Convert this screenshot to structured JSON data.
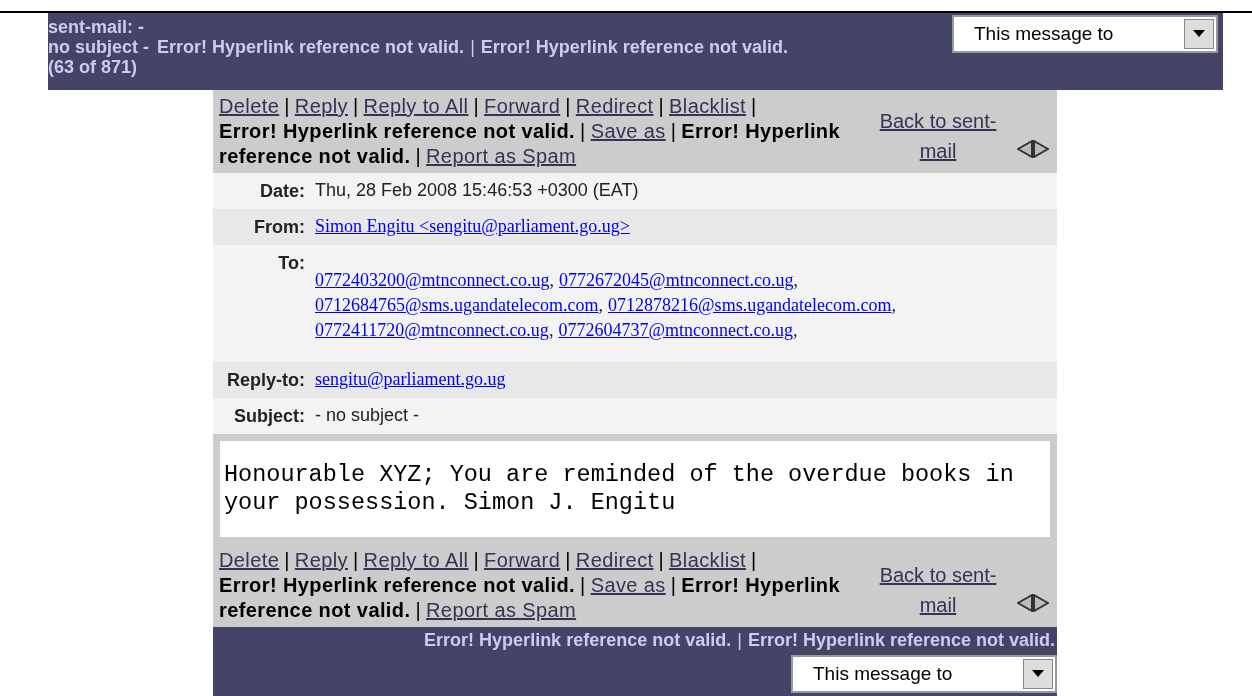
{
  "top_bar": {
    "folder": "sent-mail: -",
    "subject": "no subject -",
    "links": [
      {
        "kind": "error",
        "text": "Error! Hyperlink reference not valid."
      },
      {
        "kind": "separator",
        "text": "|"
      },
      {
        "kind": "error",
        "text": "Error! Hyperlink reference not valid."
      }
    ],
    "position": "(63 of 871)",
    "action_select": {
      "value": "This message to"
    }
  },
  "toolbars": [
    {
      "lines": [
        [
          {
            "kind": "link",
            "text": "Delete"
          },
          {
            "kind": "separator",
            "text": "|"
          },
          {
            "kind": "link",
            "text": "Reply"
          },
          {
            "kind": "separator",
            "text": "|"
          },
          {
            "kind": "link",
            "text": "Reply to All"
          },
          {
            "kind": "separator",
            "text": "|"
          },
          {
            "kind": "link",
            "text": "Forward"
          },
          {
            "kind": "separator",
            "text": "|"
          },
          {
            "kind": "link",
            "text": "Redirect"
          },
          {
            "kind": "separator",
            "text": "|"
          },
          {
            "kind": "link",
            "text": "Blacklist"
          },
          {
            "kind": "separator",
            "text": "|"
          }
        ],
        [
          {
            "kind": "error",
            "text": "Error! Hyperlink reference not valid."
          },
          {
            "kind": "separator",
            "text": "|"
          },
          {
            "kind": "link",
            "text": "Save as"
          },
          {
            "kind": "separator",
            "text": "|"
          },
          {
            "kind": "error",
            "text": "Error! Hyperlink"
          }
        ],
        [
          {
            "kind": "error",
            "text": "reference not valid."
          },
          {
            "kind": "separator",
            "text": "|"
          },
          {
            "kind": "link",
            "text": "Report as Spam"
          }
        ]
      ],
      "back_link": "Back to sent-mail"
    },
    {
      "lines": [
        [
          {
            "kind": "link",
            "text": "Delete"
          },
          {
            "kind": "separator",
            "text": "|"
          },
          {
            "kind": "link",
            "text": "Reply"
          },
          {
            "kind": "separator",
            "text": "|"
          },
          {
            "kind": "link",
            "text": "Reply to All"
          },
          {
            "kind": "separator",
            "text": "|"
          },
          {
            "kind": "link",
            "text": "Forward"
          },
          {
            "kind": "separator",
            "text": "|"
          },
          {
            "kind": "link",
            "text": "Redirect"
          },
          {
            "kind": "separator",
            "text": "|"
          },
          {
            "kind": "link",
            "text": "Blacklist"
          },
          {
            "kind": "separator",
            "text": "|"
          }
        ],
        [
          {
            "kind": "error",
            "text": "Error! Hyperlink reference not valid."
          },
          {
            "kind": "separator",
            "text": "|"
          },
          {
            "kind": "link",
            "text": "Save as"
          },
          {
            "kind": "separator",
            "text": "|"
          },
          {
            "kind": "error",
            "text": "Error! Hyperlink"
          }
        ],
        [
          {
            "kind": "error",
            "text": "reference not valid."
          },
          {
            "kind": "separator",
            "text": "|"
          },
          {
            "kind": "link",
            "text": "Report as Spam"
          }
        ]
      ],
      "back_link": "Back to sent-mail"
    }
  ],
  "headers": [
    {
      "label": "Date:",
      "kind": "text",
      "value": "Thu, 28 Feb 2008 15:46:53 +0300 (EAT)"
    },
    {
      "label": "From:",
      "kind": "links",
      "links": [
        {
          "text": "Simon Engitu <sengitu@parliament.go.ug>"
        }
      ]
    },
    {
      "label": "To:",
      "kind": "links",
      "links": [
        {
          "text": "0772403200@mtnconnect.co.ug",
          "trailing": ","
        },
        {
          "text": "0772672045@mtnconnect.co.ug",
          "trailing": ","
        },
        {
          "text": "0712684765@sms.ugandatelecom.com",
          "trailing": ","
        },
        {
          "text": "0712878216@sms.ugandatelecom.com",
          "trailing": ","
        },
        {
          "text": "0772411720@mtnconnect.co.ug",
          "trailing": ","
        },
        {
          "text": "0772604737@mtnconnect.co.ug",
          "trailing": ","
        }
      ]
    },
    {
      "label": "Reply-to:",
      "kind": "links",
      "links": [
        {
          "text": "sengitu@parliament.go.ug"
        }
      ]
    },
    {
      "label": "Subject:",
      "kind": "text",
      "value": "- no subject -"
    }
  ],
  "body": "Honourable XYZ; You are reminded of the overdue books in your possession. Simon J. Engitu",
  "bottom_bar": {
    "links": [
      {
        "kind": "error",
        "text": "Error! Hyperlink reference not valid."
      },
      {
        "kind": "separator",
        "text": "|"
      },
      {
        "kind": "error",
        "text": "Error! Hyperlink reference not valid."
      }
    ],
    "action_select": {
      "value": "This message to"
    }
  }
}
